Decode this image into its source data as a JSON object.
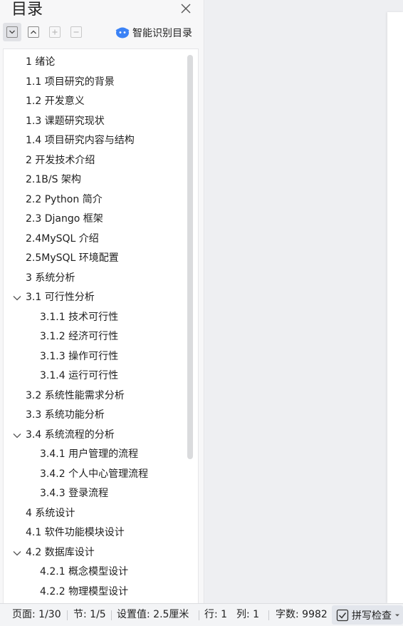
{
  "toc_panel": {
    "title": "目录",
    "toolbar": {
      "smart_label": "智能识别目录"
    },
    "items": [
      {
        "label": "1 绪论",
        "level": 1,
        "expandable": false
      },
      {
        "label": "1.1 项目研究的背景",
        "level": 1,
        "expandable": false
      },
      {
        "label": "1.2 开发意义",
        "level": 1,
        "expandable": false
      },
      {
        "label": "1.3  课题研究现状",
        "level": 1,
        "expandable": false
      },
      {
        "label": "1.4 项目研究内容与结构",
        "level": 1,
        "expandable": false
      },
      {
        "label": "2 开发技术介绍",
        "level": 1,
        "expandable": false
      },
      {
        "label": "2.1B/S 架构",
        "level": 1,
        "expandable": false
      },
      {
        "label": "2.2 Python 简介",
        "level": 1,
        "expandable": false
      },
      {
        "label": "2.3 Django 框架",
        "level": 1,
        "expandable": false
      },
      {
        "label": "2.4MySQL  介绍",
        "level": 1,
        "expandable": false
      },
      {
        "label": "2.5MySQL 环境配置",
        "level": 1,
        "expandable": false
      },
      {
        "label": "3 系统分析",
        "level": 1,
        "expandable": false
      },
      {
        "label": "3.1 可行性分析",
        "level": 1,
        "expandable": true
      },
      {
        "label": "3.1.1 技术可行性",
        "level": 2,
        "expandable": false
      },
      {
        "label": "3.1.2 经济可行性",
        "level": 2,
        "expandable": false
      },
      {
        "label": "3.1.3 操作可行性",
        "level": 2,
        "expandable": false
      },
      {
        "label": "3.1.4  运行可行性",
        "level": 2,
        "expandable": false
      },
      {
        "label": "3.2 系统性能需求分析",
        "level": 1,
        "expandable": false
      },
      {
        "label": "3.3 系统功能分析",
        "level": 1,
        "expandable": false
      },
      {
        "label": "3.4 系统流程的分析",
        "level": 1,
        "expandable": true
      },
      {
        "label": "3.4.1  用户管理的流程",
        "level": 2,
        "expandable": false
      },
      {
        "label": "3.4.2 个人中心管理流程",
        "level": 2,
        "expandable": false
      },
      {
        "label": "3.4.3 登录流程",
        "level": 2,
        "expandable": false
      },
      {
        "label": "4 系统设计",
        "level": 1,
        "expandable": false
      },
      {
        "label": "4.1  软件功能模块设计",
        "level": 1,
        "expandable": false
      },
      {
        "label": "4.2 数据库设计",
        "level": 1,
        "expandable": true
      },
      {
        "label": "4.2.1 概念模型设计",
        "level": 2,
        "expandable": false
      },
      {
        "label": "4.2.2 物理模型设计",
        "level": 2,
        "expandable": false
      }
    ]
  },
  "status_bar": {
    "page": "页面: 1/30",
    "section": "节: 1/5",
    "setting": "设置值: 2.5厘米",
    "row": "行: 1",
    "col": "列: 1",
    "words": "字数: 9982",
    "spell_check": "拼写检查"
  },
  "colors": {
    "accent": "#3b82f6",
    "panel_bg": "#f7f7f8"
  }
}
